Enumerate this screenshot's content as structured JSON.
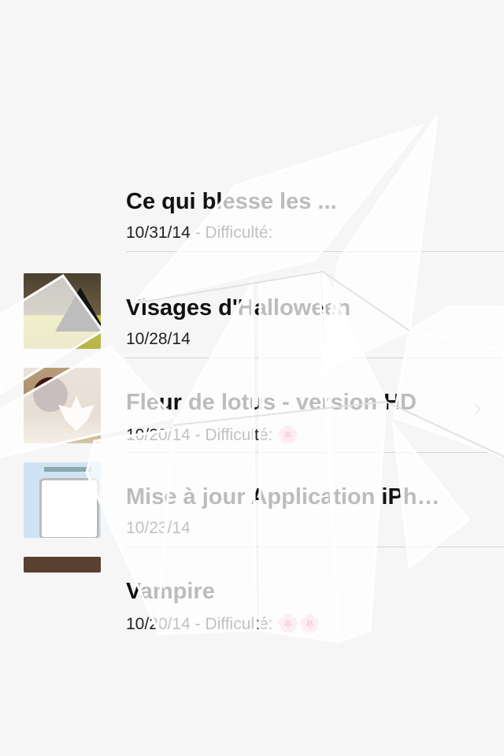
{
  "list": {
    "rows": [
      {
        "title": "Ce qui blesse les ...",
        "subtitle": "10/31/14 - Difficulté:",
        "flowers": ""
      },
      {
        "title": "Visages d'Halloween",
        "subtitle": "10/28/14",
        "flowers": ""
      },
      {
        "title": "Fleur de lotus - version HD",
        "subtitle": "10/20/14 - Difficulté:",
        "flowers": "🌸"
      },
      {
        "title": "Mise à jour Application iPh…",
        "subtitle": "10/23/14",
        "flowers": ""
      },
      {
        "title": "Vampire",
        "subtitle": "10/20/14 - Difficulté:",
        "flowers": "🌸🌸"
      }
    ],
    "chevron": "›"
  },
  "icons": {
    "chevron": "chevron-right-icon",
    "difficulty": "cherry-blossom-icon"
  },
  "colors": {
    "background": "#f6f6f6",
    "separator": "#d4d4d4",
    "chevron": "#c7c7cc"
  }
}
